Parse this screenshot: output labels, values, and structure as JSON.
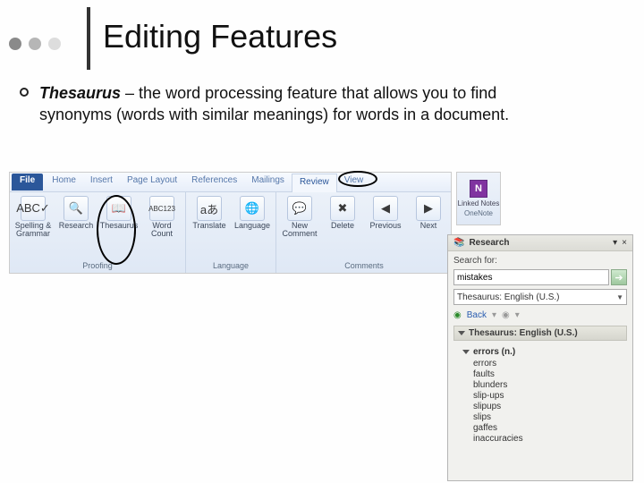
{
  "decor": {
    "dots": [
      "#8a8a8a",
      "#b6b6b6",
      "#dddddd"
    ]
  },
  "title": "Editing Features",
  "bullet": {
    "term": "Thesaurus",
    "rest": " – the word processing feature that allows you to find synonyms (words with similar meanings) for words in a document."
  },
  "ribbon": {
    "tabs": [
      "File",
      "Home",
      "Insert",
      "Page Layout",
      "References",
      "Mailings",
      "Review",
      "View"
    ],
    "active_tab": "Review",
    "groups": [
      {
        "label": "Proofing",
        "buttons": [
          {
            "icon": "ABC✓",
            "label": "Spelling & Grammar"
          },
          {
            "icon": "🔍",
            "label": "Research"
          },
          {
            "icon": "📖",
            "label": "Thesaurus"
          },
          {
            "icon": "ABC123",
            "label": "Word Count"
          }
        ]
      },
      {
        "label": "Language",
        "buttons": [
          {
            "icon": "aあ",
            "label": "Translate"
          },
          {
            "icon": "🌐",
            "label": "Language"
          }
        ]
      },
      {
        "label": "Comments",
        "buttons": [
          {
            "icon": "💬",
            "label": "New Comment"
          },
          {
            "icon": "✖",
            "label": "Delete"
          },
          {
            "icon": "◀",
            "label": "Previous"
          },
          {
            "icon": "▶",
            "label": "Next"
          }
        ]
      }
    ]
  },
  "onenote": {
    "label": "Linked Notes",
    "group": "OneNote"
  },
  "pane": {
    "title": "Research",
    "search_label": "Search for:",
    "search_value": "mistakes",
    "source": "Thesaurus: English (U.S.)",
    "back": "Back",
    "section": "Thesaurus: English (U.S.)",
    "result_header": "errors (n.)",
    "results": [
      "errors",
      "faults",
      "blunders",
      "slip-ups",
      "slipups",
      "slips",
      "gaffes",
      "inaccuracies"
    ]
  }
}
